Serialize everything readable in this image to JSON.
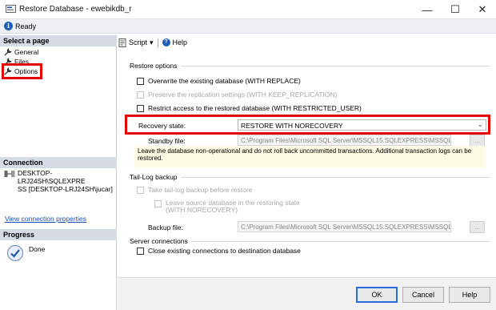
{
  "window": {
    "title": "Restore Database - ewebikdb_r",
    "minimize_glyph": "—",
    "maximize_glyph": "☐",
    "close_glyph": "✕"
  },
  "status": {
    "text": "Ready",
    "icon": "info-icon"
  },
  "left_pane": {
    "select_page_heading": "Select a page",
    "pages": [
      {
        "label": "General",
        "icon": "wrench-icon"
      },
      {
        "label": "Files",
        "icon": "wrench-icon"
      },
      {
        "label": "Options",
        "icon": "wrench-icon",
        "selected": true
      }
    ],
    "connection_heading": "Connection",
    "connection_text": "DESKTOP-LRJ24SH\\SQLEXPRESS [DESKTOP-LRJ24SH\\jucar]",
    "connection_line1": "DESKTOP-LRJ24SH\\SQLEXPRE",
    "connection_line2": "SS [DESKTOP-LRJ24SH\\jucar]",
    "view_connection_link": "View connection properties",
    "progress_heading": "Progress",
    "progress_status": "Done"
  },
  "toolbar": {
    "script_label": "Script",
    "script_dropdown_glyph": "▾",
    "help_label": "Help"
  },
  "restore_options": {
    "group_label": "Restore options",
    "overwrite_label": "Overwrite the existing database (WITH REPLACE)",
    "overwrite_checked": false,
    "preserve_label": "Preserve the replication settings (WITH KEEP_REPLICATION)",
    "preserve_enabled": false,
    "restrict_label": "Restrict access to the restored database (WITH RESTRICTED_USER)",
    "restrict_checked": false,
    "recovery_state_label": "Recovery state:",
    "recovery_state_value": "RESTORE WITH NORECOVERY",
    "standby_file_label": "Standby file:",
    "standby_file_value": "C:\\Program Files\\Microsoft SQL Server\\MSSQL15.SQLEXPRESS\\MSSQL\\E",
    "note": "Leave the database non-operational and do not roll back uncommitted transactions. Additional transaction logs can be restored."
  },
  "tail_log": {
    "group_label": "Tail-Log backup",
    "take_tail_log_label": "Take tail-log backup before restore",
    "leave_source_label_line1": "Leave source database in the restoring state",
    "leave_source_label_line2": "(WITH NORECOVERY)",
    "backup_file_label": "Backup file:",
    "backup_file_value": "C:\\Program Files\\Microsoft SQL Server\\MSSQL15.SQLEXPRESS\\MSSQL\\E"
  },
  "server_connections": {
    "group_label": "Server connections",
    "close_existing_label": "Close existing connections to destination database"
  },
  "browse_glyph": "...",
  "dialog_buttons": {
    "ok": "OK",
    "cancel": "Cancel",
    "help": "Help"
  },
  "colors": {
    "highlight": "#e60000",
    "accent": "#1c5fb5",
    "link": "#1a4fb5"
  }
}
